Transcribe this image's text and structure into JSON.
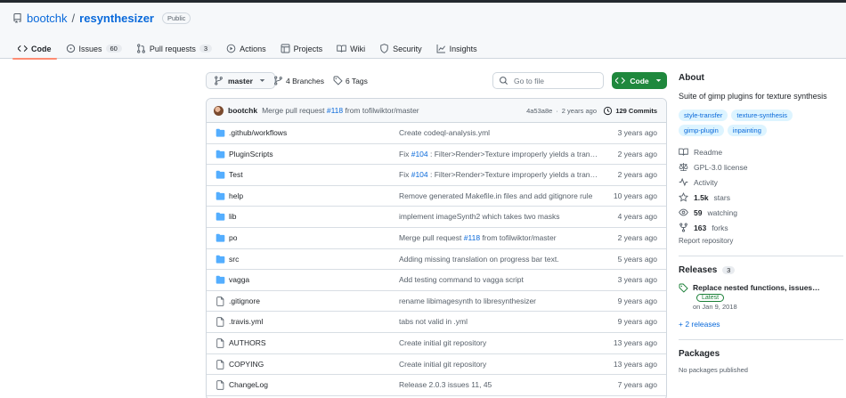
{
  "repo": {
    "owner": "bootchk",
    "separator": "/",
    "name": "resynthesizer",
    "visibility": "Public"
  },
  "tabs": [
    {
      "label": "Code",
      "icon": "code-icon",
      "active": true
    },
    {
      "label": "Issues",
      "icon": "issue-icon",
      "count": "60"
    },
    {
      "label": "Pull requests",
      "icon": "pull-request-icon",
      "count": "3"
    },
    {
      "label": "Actions",
      "icon": "play-icon"
    },
    {
      "label": "Projects",
      "icon": "table-icon"
    },
    {
      "label": "Wiki",
      "icon": "book-icon"
    },
    {
      "label": "Security",
      "icon": "shield-icon"
    },
    {
      "label": "Insights",
      "icon": "graph-icon"
    }
  ],
  "toolbar": {
    "branch": "master",
    "branches": "4 Branches",
    "tags": "6 Tags",
    "search_placeholder": "Go to file",
    "code_label": "Code"
  },
  "latest_commit": {
    "author": "bootchk",
    "message_prefix": "Merge pull request",
    "pr": "#118",
    "message_suffix": "from tofilwiktor/master",
    "sha": "4a53a8e",
    "sep": "·",
    "time": "2 years ago",
    "commits": "129 Commits"
  },
  "files": [
    {
      "type": "dir",
      "name": ".github/workflows",
      "commit": "Create codeql-analysis.yml",
      "date": "3 years ago"
    },
    {
      "type": "dir",
      "name": "PluginScripts",
      "commit_prefix": "Fix",
      "pr": "#104",
      "commit": ": Filter>Render>Texture improperly yields a transparent…",
      "date": "2 years ago"
    },
    {
      "type": "dir",
      "name": "Test",
      "commit_prefix": "Fix",
      "pr": "#104",
      "commit": ": Filter>Render>Texture improperly yields a transparent…",
      "date": "2 years ago"
    },
    {
      "type": "dir",
      "name": "help",
      "commit": "Remove generated Makefile.in files and add gitignore rule",
      "date": "10 years ago"
    },
    {
      "type": "dir",
      "name": "lib",
      "commit": "implement imageSynth2 which takes two masks",
      "date": "4 years ago"
    },
    {
      "type": "dir",
      "name": "po",
      "commit_prefix": "Merge pull request",
      "pr": "#118",
      "commit": "from tofilwiktor/master",
      "date": "2 years ago"
    },
    {
      "type": "dir",
      "name": "src",
      "commit": "Adding missing translation on progress bar text.",
      "date": "5 years ago"
    },
    {
      "type": "dir",
      "name": "vagga",
      "commit": "Add testing command to vagga script",
      "date": "3 years ago"
    },
    {
      "type": "file",
      "name": ".gitignore",
      "commit": "rename libimagesynth to libresynthesizer",
      "date": "9 years ago"
    },
    {
      "type": "file",
      "name": ".travis.yml",
      "commit": "tabs not valid in .yml",
      "date": "9 years ago"
    },
    {
      "type": "file",
      "name": "AUTHORS",
      "commit": "Create initial git repository",
      "date": "13 years ago"
    },
    {
      "type": "file",
      "name": "COPYING",
      "commit": "Create initial git repository",
      "date": "13 years ago"
    },
    {
      "type": "file",
      "name": "ChangeLog",
      "commit": "Release 2.0.3 issues 11, 45",
      "date": "7 years ago"
    }
  ],
  "about": {
    "heading": "About",
    "description": "Suite of gimp plugins for texture synthesis",
    "topics": [
      "style-transfer",
      "texture-synthesis",
      "gimp-plugin",
      "inpainting"
    ],
    "readme": "Readme",
    "license": "GPL-3.0 license",
    "activity": "Activity",
    "stars_value": "1.5k",
    "stars_label": "stars",
    "watching_value": "59",
    "watching_label": "watching",
    "forks_value": "163",
    "forks_label": "forks",
    "report": "Report repository"
  },
  "releases": {
    "heading": "Releases",
    "count": "3",
    "latest_title": "Replace nested functions, issues…",
    "latest_badge": "Latest",
    "latest_date": "on Jan 9, 2018",
    "more": "+ 2 releases"
  },
  "packages": {
    "heading": "Packages",
    "empty": "No packages published"
  },
  "colors": {
    "accent": "#0969da",
    "green": "#1f883d",
    "tab_underline": "#fd8c73",
    "folder": "#54aeff"
  }
}
